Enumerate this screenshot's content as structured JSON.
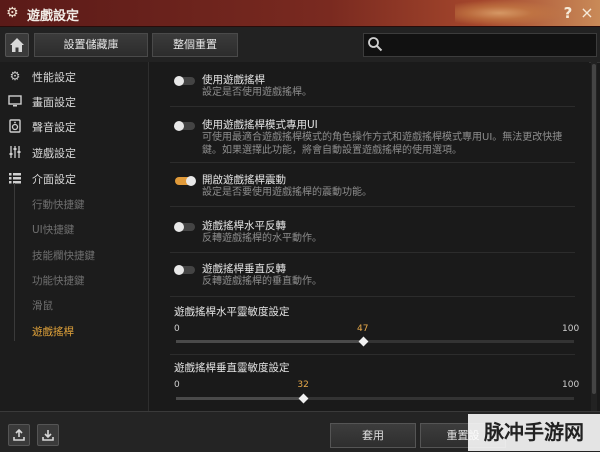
{
  "window": {
    "title": "遊戲設定",
    "help_label": "?",
    "close_label": "×"
  },
  "toolbar": {
    "presets_label": "設置儲藏庫",
    "reset_all_label": "整個重置",
    "search_placeholder": ""
  },
  "sidebar": {
    "categories": [
      {
        "label": "性能設定",
        "icon": "gears-icon"
      },
      {
        "label": "畫面設定",
        "icon": "monitor-icon"
      },
      {
        "label": "聲音設定",
        "icon": "speaker-icon"
      },
      {
        "label": "遊戲設定",
        "icon": "sliders-icon"
      },
      {
        "label": "介面設定",
        "icon": "list-icon"
      }
    ],
    "subitems": [
      "行動快捷鍵",
      "UI快捷鍵",
      "技能欄快捷鍵",
      "功能快捷鍵",
      "滑鼠",
      "遊戲搖桿"
    ],
    "active_subitem": "遊戲搖桿"
  },
  "options": [
    {
      "title": "使用遊戲搖桿",
      "desc": "設定是否使用遊戲搖桿。",
      "enabled": false
    },
    {
      "title": "使用遊戲搖桿模式專用UI",
      "desc": "可使用最適合遊戲搖桿模式的角色操作方式和遊戲搖桿模式專用UI。無法更改快捷鍵。如果選擇此功能，將會自動設置遊戲搖桿的使用選項。",
      "enabled": false
    },
    {
      "title": "開啟遊戲搖桿震動",
      "desc": "設定是否要使用遊戲搖桿的震動功能。",
      "enabled": true
    },
    {
      "title": "遊戲搖桿水平反轉",
      "desc": "反轉遊戲搖桿的水平動作。",
      "enabled": false
    },
    {
      "title": "遊戲搖桿垂直反轉",
      "desc": "反轉遊戲搖桿的垂直動作。",
      "enabled": false
    }
  ],
  "sliders": [
    {
      "title": "遊戲搖桿水平靈敏度設定",
      "min": 0,
      "max": 100,
      "value": 47,
      "min_label": "0",
      "max_label": "100",
      "value_label": "47"
    },
    {
      "title": "遊戲搖桿垂直靈敏度設定",
      "min": 0,
      "max": 100,
      "value": 32,
      "min_label": "0",
      "max_label": "100",
      "value_label": "32"
    }
  ],
  "footer": {
    "apply_label": "套用",
    "reset_label": "重置設",
    "watermark": "脉冲手游网"
  },
  "colors": {
    "accent": "#e09a3a",
    "title_bar": "#7a2a20"
  }
}
